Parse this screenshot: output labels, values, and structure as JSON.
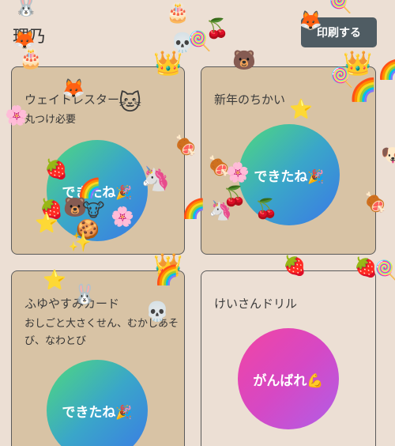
{
  "header": {
    "name": "理乃",
    "print_label": "印刷する"
  },
  "cards": [
    {
      "title": "ウェイトレスター",
      "subtitle": "丸つけ必要",
      "badge": "できたね🎉",
      "status": "done"
    },
    {
      "title": "新年のちかい",
      "subtitle": "",
      "badge": "できたね🎉",
      "status": "done"
    },
    {
      "title": "ふゆやすみカード",
      "subtitle": "おしごと大さくせん、むかしあそび、なわとび",
      "badge": "できたね🎉",
      "status": "done"
    },
    {
      "title": "けいさんドリル",
      "subtitle": "",
      "badge": "がんばれ💪",
      "status": "todo"
    }
  ],
  "stickers": {
    "crown": "👑",
    "rainbow": "🌈",
    "fox": "🦊",
    "cat": "🐱",
    "unicorn": "🦄",
    "strawberry": "🍓",
    "cherry_blossom": "🌸",
    "star": "⭐",
    "sparkle": "✨",
    "cake": "🎂",
    "candy": "🍭",
    "cherries": "🍒",
    "skull": "💀",
    "bear": "🐻",
    "dog": "🐶",
    "meat": "🍖",
    "rabbit": "🐰",
    "cow": "🐮",
    "cookie": "🍪"
  },
  "colors": {
    "background": "#ecdfd4",
    "card_done": "#d8c3a5",
    "print_button": "#4f5c63"
  }
}
